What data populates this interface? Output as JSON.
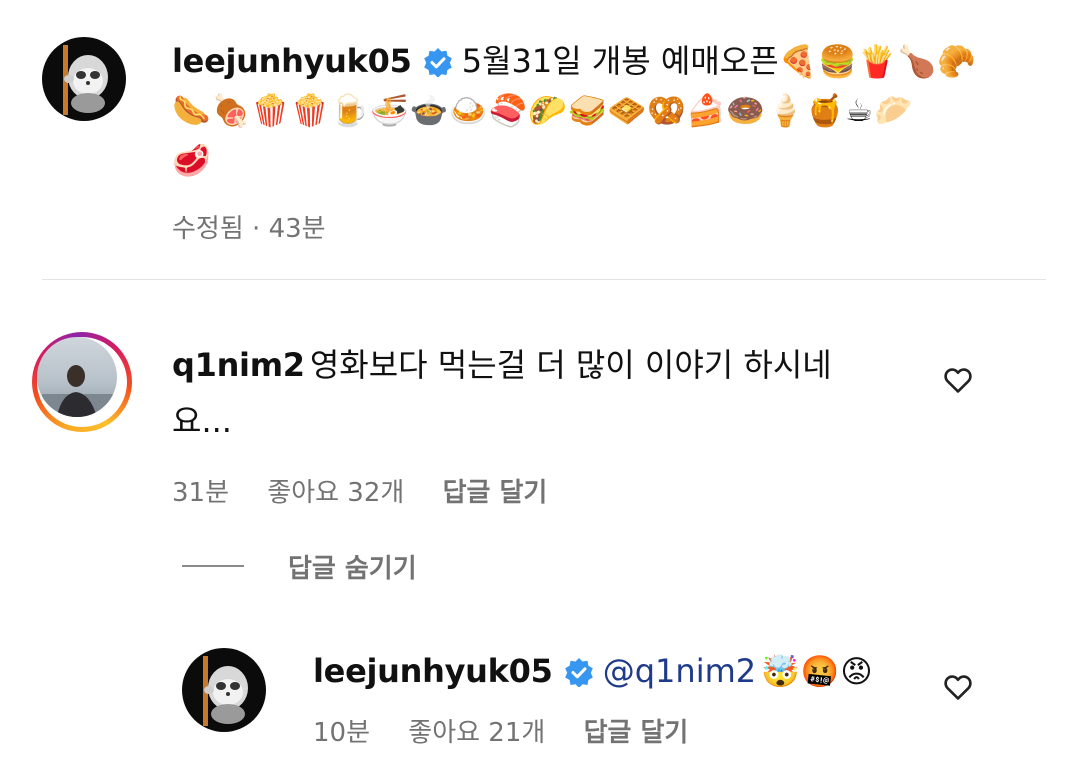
{
  "comments": [
    {
      "username": "leejunhyuk05",
      "verified": true,
      "text": "5월31일 개봉 예매오픈",
      "emoji_line1": "🍕🍔🍟🍗🥐",
      "emoji_line2": "🌭🍖🍿🍿🍺🍜🍲🍛🍣🌮🥪🧇🥨🍰🍩🍦🍯☕🥟",
      "emoji_line3": "🥩",
      "edited_label": "수정됨",
      "time": "43분"
    },
    {
      "username": "q1nim2",
      "text_line1": "영화보다 먹는걸 더 많이 이야기 하시네",
      "text_line2": "요...",
      "time": "31분",
      "likes": "좋아요 32개",
      "reply_label": "답글 달기"
    }
  ],
  "hide_replies_label": "답글 숨기기",
  "reply": {
    "username": "leejunhyuk05",
    "verified": true,
    "mention": "@q1nim2",
    "emojis": "🤯🤬😡",
    "time": "10분",
    "likes": "좋아요 21개",
    "reply_label": "답글 달기"
  },
  "colors": {
    "verified_blue": "#3797f0",
    "meta_gray": "#737373"
  },
  "icons": [
    "heart-outline-icon",
    "verified-badge-icon"
  ]
}
